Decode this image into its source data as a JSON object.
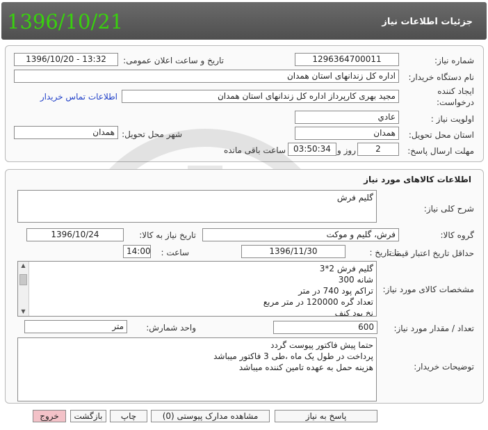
{
  "header": {
    "date_stamp": "1396/10/21",
    "title": "جزئیات اطلاعات نیاز"
  },
  "need_info": {
    "need_number_label": "شماره نیاز:",
    "need_number": "1296364700011",
    "announce_label": "تاریخ و ساعت اعلان عمومی:",
    "announce_value": "1396/10/20 - 13:32",
    "buyer_org_label": "نام دستگاه خریدار:",
    "buyer_org": "اداره کل زندانهای استان همدان",
    "creator_label_1": "ایجاد کننده",
    "creator_label_2": "درخواست:",
    "creator": "مجید بهری کارپرداز اداره کل زندانهای استان همدان",
    "contact_link": "اطلاعات تماس خریدار",
    "priority_label": "اولویت نیاز :",
    "priority": "عادي",
    "province_label": "استان محل تحویل:",
    "province": "همدان",
    "city_label": "شهر محل تحویل:",
    "city": "همدان",
    "deadline_label": "مهلت ارسال پاسخ:",
    "days_value": "2",
    "days_word": "روز و",
    "time_value": "03:50:34",
    "remaining_word": "ساعت باقی مانده"
  },
  "goods": {
    "section_title": "اطلاعات کالاهای مورد نیاز",
    "general_desc_label": "شرح کلی نیاز:",
    "general_desc": "گلیم فرش",
    "group_label": "گروه کالا:",
    "group_value": "فرش، گلیم و موکت",
    "need_date_label": "تاریخ نیاز به کالا:",
    "need_date": "1396/10/24",
    "min_valid_label": "حداقل تاریخ اعتبار قیمت:",
    "until_label": "تا تاریخ :",
    "until_date": "1396/11/30",
    "hour_label": "ساعت :",
    "hour_value": "14:00",
    "specs_label": "مشخصات کالای مورد نیاز:",
    "specs_lines": [
      "گلیم فرش 2*3",
      "شانه 300",
      "تراکم پود 740 در متر",
      "تعداد گره 120000 در متر مربع",
      "نخ پود کنف"
    ],
    "qty_label": "تعداد / مقدار مورد نیاز:",
    "qty_value": "600",
    "unit_label": "واحد شمارش:",
    "unit_value": "متر",
    "buyer_notes_label": "توضیحات خریدار:",
    "buyer_notes_lines": [
      "حتما پیش فاکتور پیوست گردد",
      "پرداخت در طول یک ماه ،طی 3 فاکتور میباشد",
      "هزینه حمل به عهده تامین کننده میباشد"
    ]
  },
  "buttons": {
    "reply": "پاسخ به نیاز",
    "attachments": "مشاهده مدارک پیوستی (0)",
    "print": "چاپ",
    "back": "بازگشت",
    "exit": "خروج"
  },
  "colors": {
    "header_bg": "#5e5e5e",
    "date_green": "#39d10e",
    "link_blue": "#1f3fc8",
    "exit_pink": "#f3c2c8"
  }
}
